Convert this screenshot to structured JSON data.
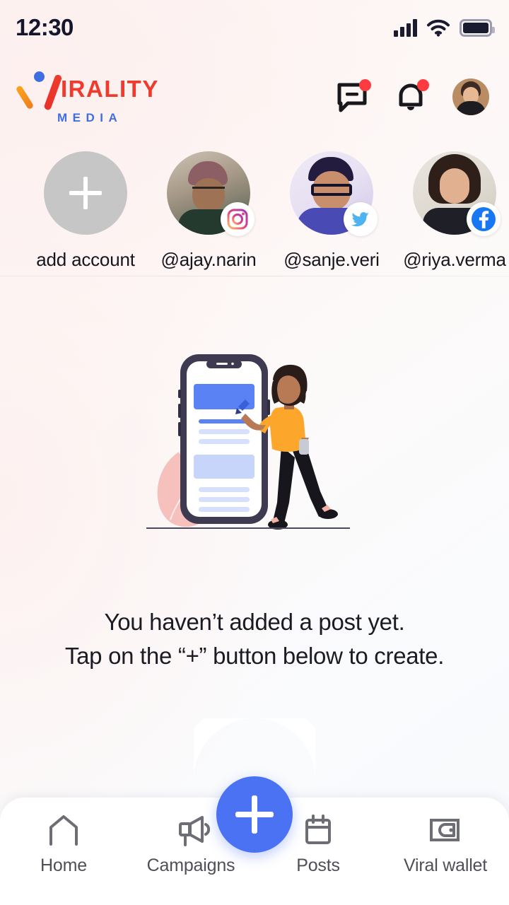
{
  "status_bar": {
    "time": "12:30",
    "signal_icon": "signal-bars-icon",
    "wifi_icon": "wifi-icon",
    "battery_icon": "battery-full-icon"
  },
  "header": {
    "brand_name": "IRALITY",
    "brand_sub": "MEDIA",
    "brand_mark_colors": {
      "orange": "#f07c1e",
      "red": "#ef3b2d",
      "blue": "#3d6fe0"
    },
    "messages_icon": "message-icon",
    "messages_badge": true,
    "notifications_icon": "bell-icon",
    "notifications_badge": true,
    "profile_avatar": "user-avatar"
  },
  "accounts": {
    "add_label": "add account",
    "items": [
      {
        "handle": "@ajay.narin",
        "network": "instagram",
        "photo": "ph-ajay"
      },
      {
        "handle": "@sanje.veri",
        "network": "twitter",
        "photo": "ph-sanje"
      },
      {
        "handle": "@riya.verma",
        "network": "facebook",
        "photo": "ph-riya"
      },
      {
        "handle": "@",
        "network": "instagram",
        "photo": "ph-extra"
      }
    ]
  },
  "empty_state": {
    "illustration": "woman-with-phone-illustration",
    "line1": "You haven’t added a post yet.",
    "line2": "Tap on the “+” button below to create."
  },
  "bottom_nav": {
    "fab_label": "+",
    "fab_color": "#4a72f2",
    "items": [
      {
        "label": "Home",
        "icon": "home-icon"
      },
      {
        "label": "Campaigns",
        "icon": "megaphone-icon"
      },
      {
        "label": "Posts",
        "icon": "calendar-icon"
      },
      {
        "label": "Viral wallet",
        "icon": "wallet-icon"
      }
    ]
  }
}
